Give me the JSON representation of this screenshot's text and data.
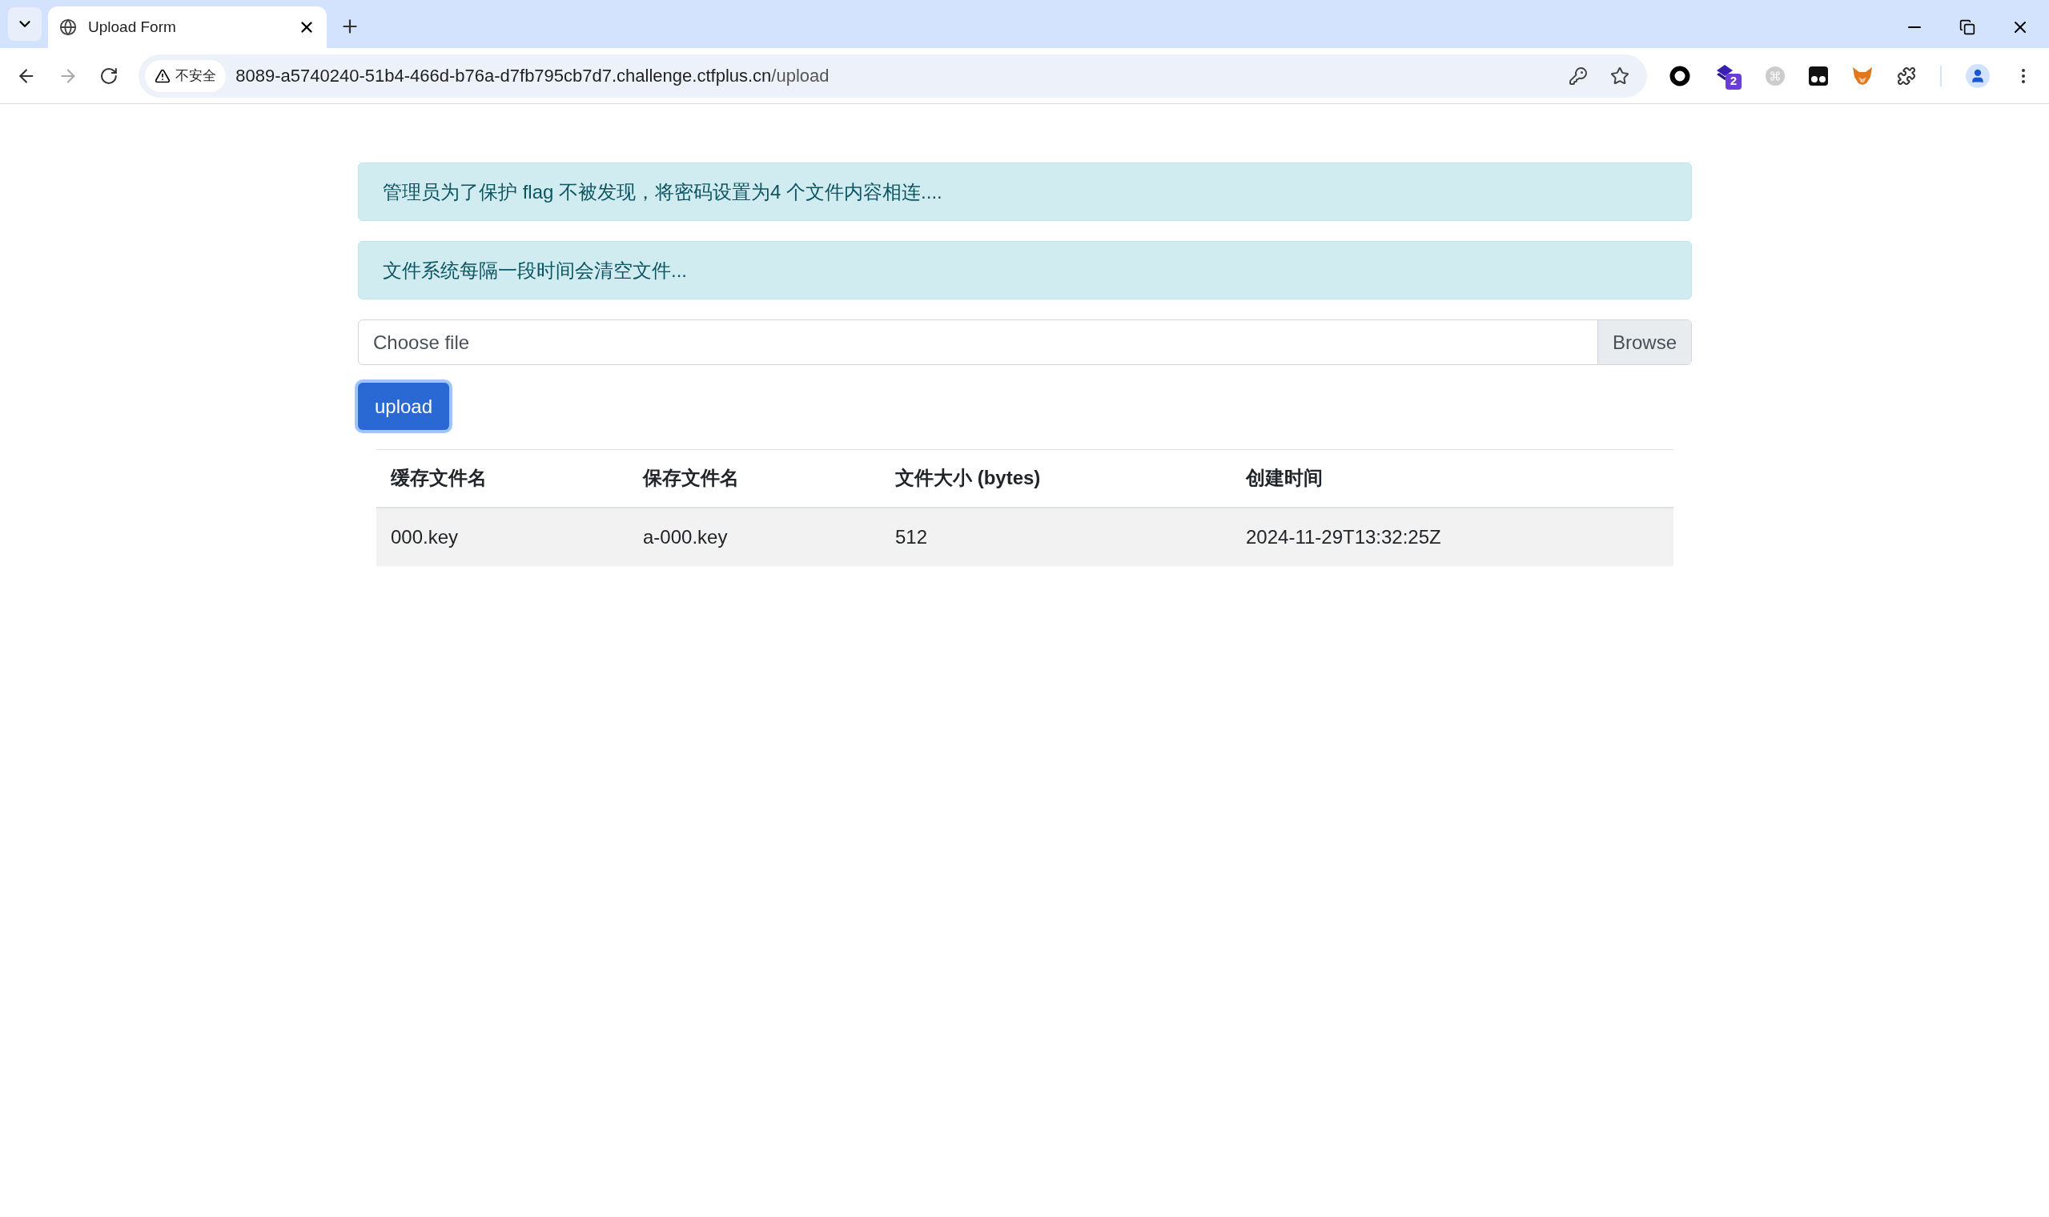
{
  "browser": {
    "tabs": [
      {
        "title": "Upload Form",
        "selected": true
      }
    ],
    "security_chip": "不安全",
    "url_host": "8089-a5740240-51b4-466d-b76a-d7fb795cb7d7.challenge.ctfplus.cn",
    "url_path": "/upload",
    "extension_badge": "2"
  },
  "alerts": [
    "管理员为了保护 flag 不被发现，将密码设置为4 个文件内容相连....",
    "文件系统每隔一段时间会清空文件..."
  ],
  "file_input": {
    "placeholder": "Choose file",
    "button": "Browse"
  },
  "upload_button": {
    "label": "upload",
    "focused": true
  },
  "table": {
    "columns": [
      "缓存文件名",
      "保存文件名",
      "文件大小 (bytes)",
      "创建时间"
    ],
    "rows": [
      [
        "000.key",
        "a-000.key",
        "512",
        "2024-11-29T13:32:25Z"
      ]
    ]
  }
}
